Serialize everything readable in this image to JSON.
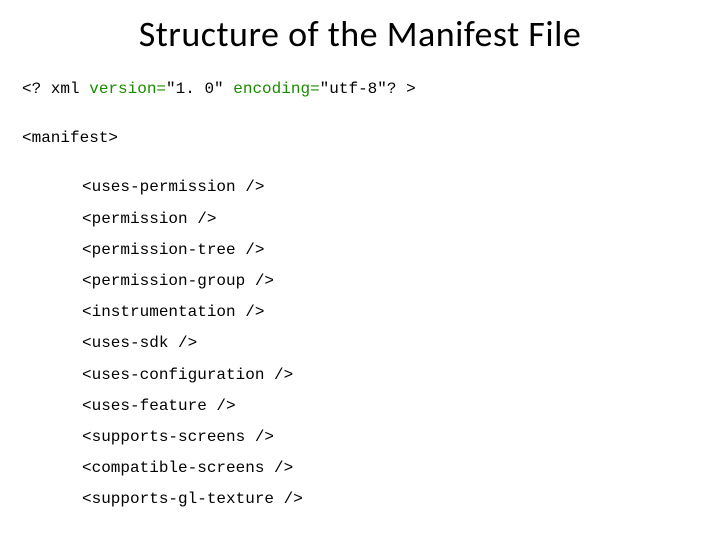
{
  "title": "Structure of the Manifest File",
  "xml_decl_part1": "<? xml ",
  "xml_decl_part2": "version=",
  "xml_decl_part3": "\"1. 0\" ",
  "xml_decl_part4": "encoding=",
  "xml_decl_part5": "\"utf-8\"",
  "xml_decl_part6": "? >",
  "manifest_open": "<manifest>",
  "tags": [
    "<uses-permission />",
    "<permission />",
    "<permission-tree />",
    "<permission-group />",
    "<instrumentation />",
    "<uses-sdk />",
    "<uses-configuration />",
    "<uses-feature />",
    "<supports-screens />",
    "<compatible-screens />",
    "<supports-gl-texture />"
  ]
}
